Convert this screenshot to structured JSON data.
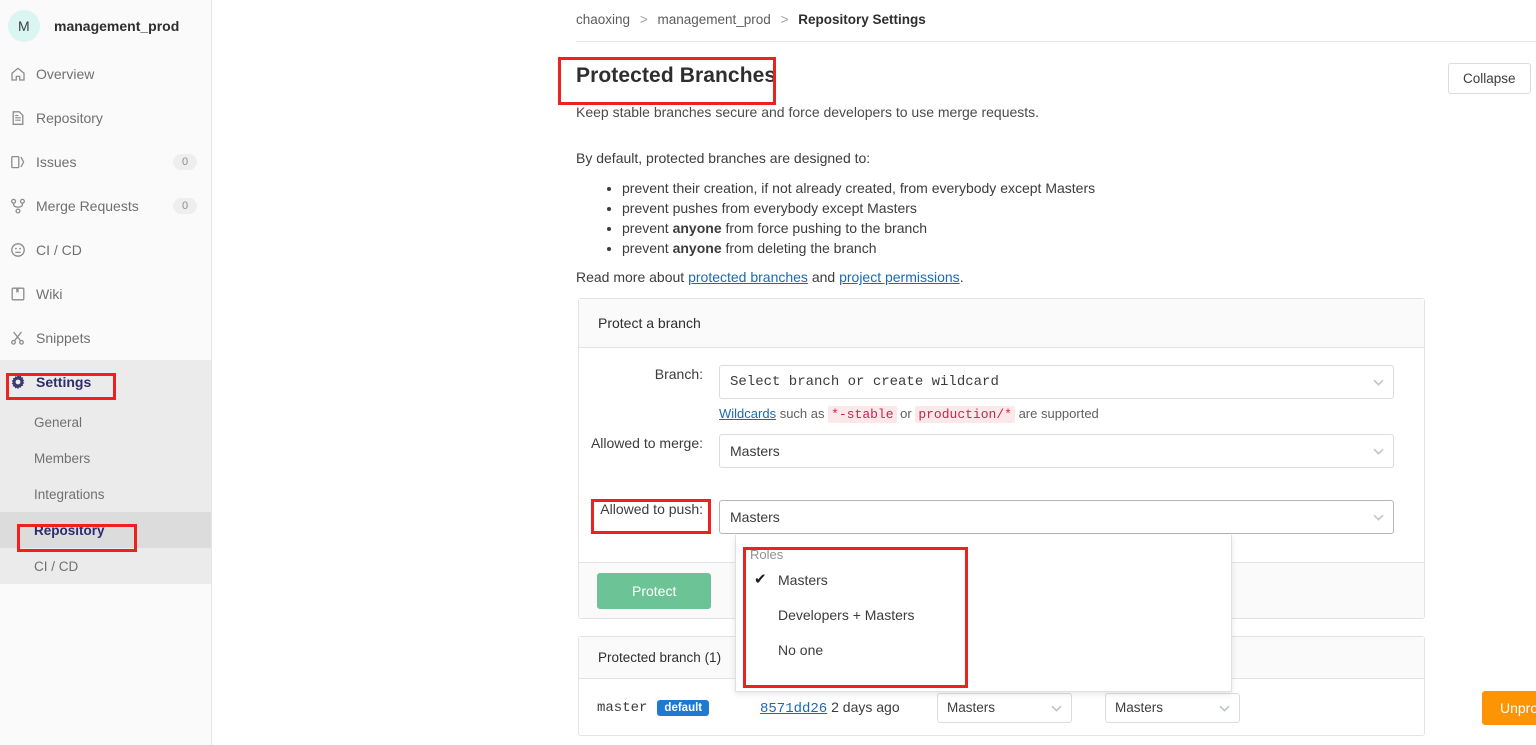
{
  "sidebar": {
    "project": {
      "initial": "M",
      "name": "management_prod"
    },
    "items": [
      {
        "label": "Overview",
        "icon": "home-icon",
        "count": null
      },
      {
        "label": "Repository",
        "icon": "document-icon",
        "count": null
      },
      {
        "label": "Issues",
        "icon": "issues-icon",
        "count": "0"
      },
      {
        "label": "Merge Requests",
        "icon": "merge-request-icon",
        "count": "0"
      },
      {
        "label": "CI / CD",
        "icon": "pipeline-icon",
        "count": null
      },
      {
        "label": "Wiki",
        "icon": "book-icon",
        "count": null
      },
      {
        "label": "Snippets",
        "icon": "scissors-icon",
        "count": null
      }
    ],
    "settings": {
      "label": "Settings",
      "icon": "gear-icon"
    },
    "sub_items": [
      {
        "label": "General",
        "active": false
      },
      {
        "label": "Members",
        "active": false
      },
      {
        "label": "Integrations",
        "active": false
      },
      {
        "label": "Repository",
        "active": true
      },
      {
        "label": "CI / CD",
        "active": false
      }
    ]
  },
  "breadcrumb": {
    "group": "chaoxing",
    "project": "management_prod",
    "current": "Repository Settings",
    "separator": ">"
  },
  "header": {
    "title": "Protected Branches",
    "subtitle": "Keep stable branches secure and force developers to use merge requests.",
    "collapse_label": "Collapse"
  },
  "description": {
    "intro": "By default, protected branches are designed to:",
    "bullets": [
      {
        "pre": "prevent their creation, if not already created, from everybody except Masters",
        "strong": "",
        "post": ""
      },
      {
        "pre": "prevent pushes from everybody except Masters",
        "strong": "",
        "post": ""
      },
      {
        "pre": "prevent ",
        "strong": "anyone",
        "post": " from force pushing to the branch"
      },
      {
        "pre": "prevent ",
        "strong": "anyone",
        "post": " from deleting the branch"
      }
    ],
    "read_more_prefix": "Read more about ",
    "link_protected_branches": "protected branches",
    "read_more_conj": " and ",
    "link_project_permissions": "project permissions",
    "read_more_suffix": "."
  },
  "protect_form": {
    "panel_title": "Protect a branch",
    "branch_label": "Branch:",
    "branch_value": "Select branch or create wildcard",
    "wildcard_link": "Wildcards",
    "wildcard_text_1": " such as ",
    "wildcard_code_1": "*-stable",
    "wildcard_text_2": " or ",
    "wildcard_code_2": "production/*",
    "wildcard_text_3": " are supported",
    "merge_label": "Allowed to merge:",
    "merge_value": "Masters",
    "push_label": "Allowed to push:",
    "push_value": "Masters",
    "submit_label": "Protect"
  },
  "dropdown": {
    "section_label": "Roles",
    "options": [
      {
        "label": "Masters",
        "selected": true
      },
      {
        "label": "Developers + Masters",
        "selected": false
      },
      {
        "label": "No one",
        "selected": false
      }
    ]
  },
  "protected_table": {
    "title": "Protected branch (1)",
    "rows": [
      {
        "branch": "master",
        "tag": "default",
        "commit_sha": "8571dd26",
        "commit_time": "2 days ago",
        "merge_value": "Masters",
        "push_value": "Masters",
        "action_label": "Unprotect"
      }
    ]
  },
  "colors": {
    "accent_blue": "#1b69b6",
    "protect_green": "#6cc396",
    "unprotect_orange": "#fc9403",
    "tag_blue": "#1f78d1",
    "annotation_red": "#ef2020",
    "code_red": "#c7254e"
  }
}
